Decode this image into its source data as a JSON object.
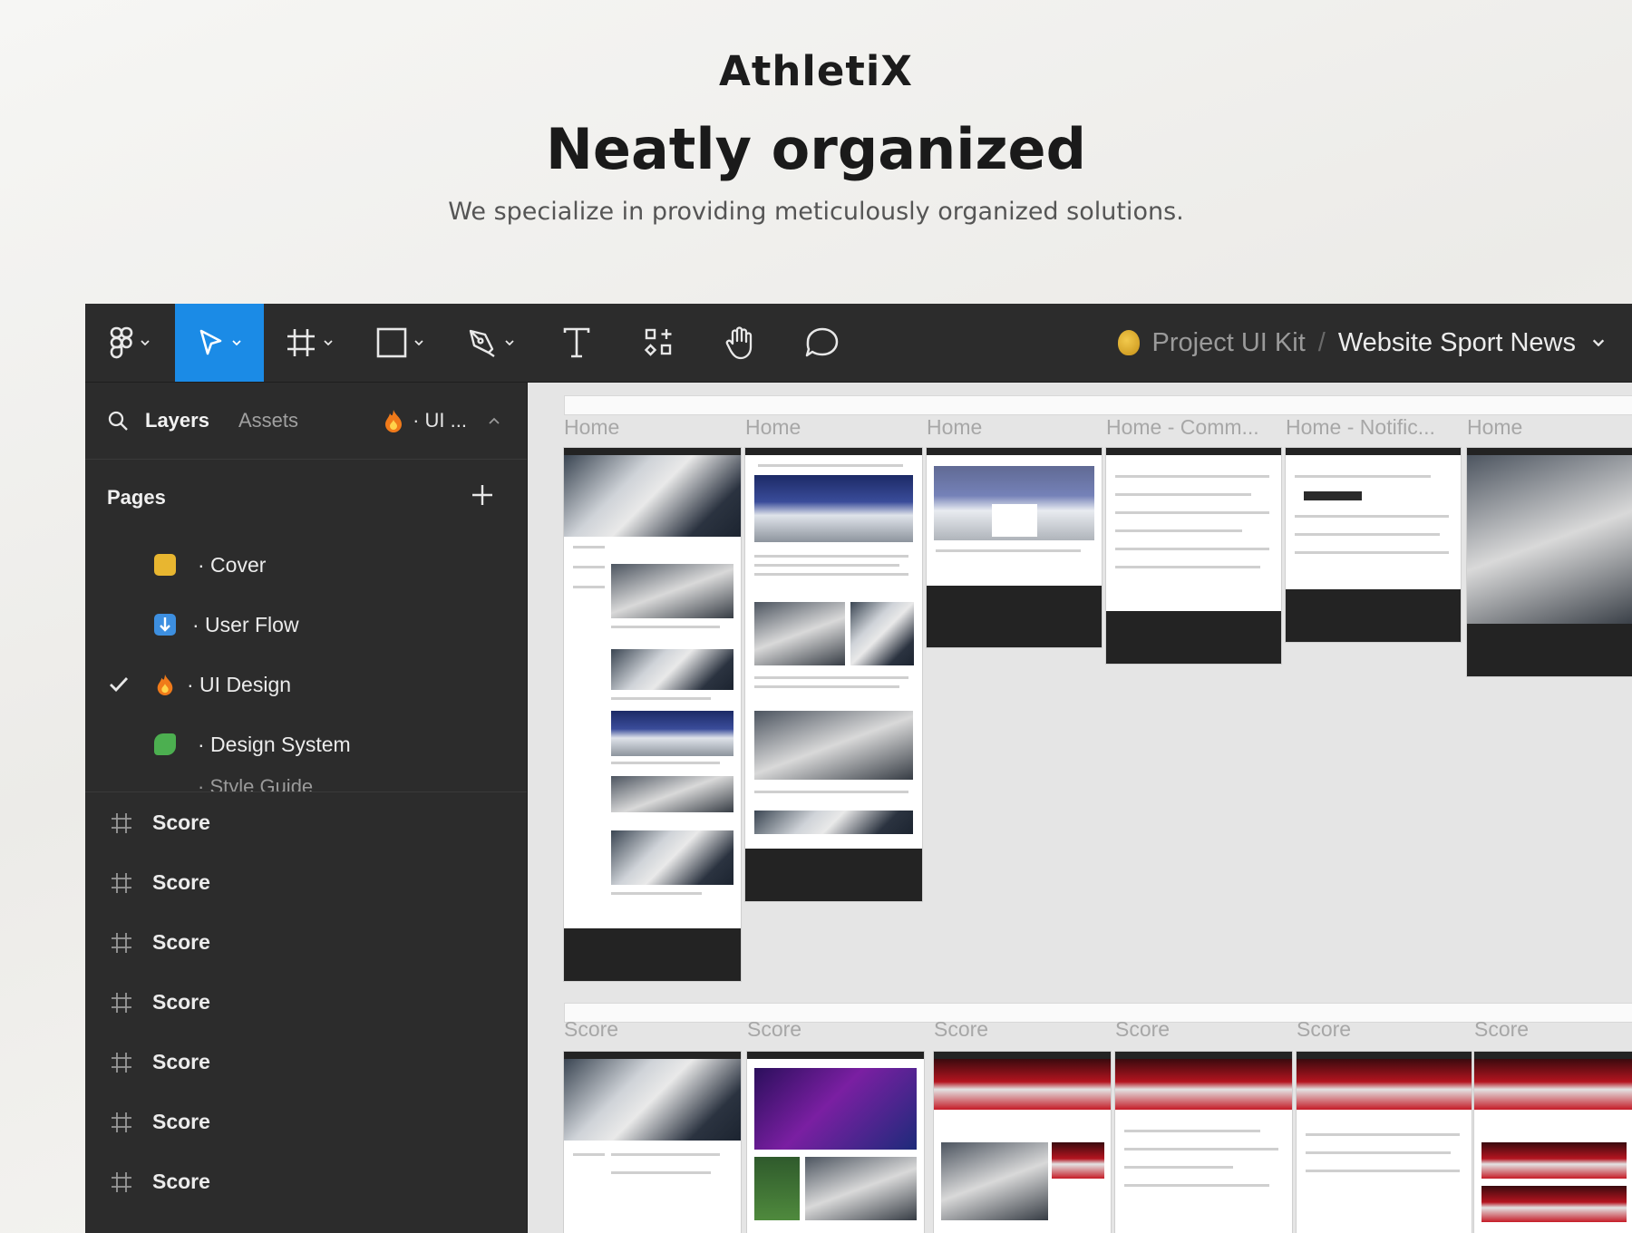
{
  "hero": {
    "brand": "AthletiX",
    "headline": "Neatly organized",
    "subtitle": "We specialize in providing meticulously organized solutions."
  },
  "toolbar": {
    "tools": [
      {
        "name": "main-menu",
        "icon": "figma-logo-icon",
        "active": false
      },
      {
        "name": "move",
        "icon": "cursor-arrow-icon",
        "active": true
      },
      {
        "name": "frame",
        "icon": "frame-hash-icon",
        "active": false
      },
      {
        "name": "shape",
        "icon": "rectangle-icon",
        "active": false
      },
      {
        "name": "pen",
        "icon": "pen-nib-icon",
        "active": false
      },
      {
        "name": "text",
        "icon": "text-t-icon",
        "active": false
      },
      {
        "name": "resources",
        "icon": "components-icon",
        "active": false
      },
      {
        "name": "hand",
        "icon": "hand-icon",
        "active": false
      },
      {
        "name": "comment",
        "icon": "comment-bubble-icon",
        "active": false
      }
    ],
    "project": "Project UI Kit",
    "separator": "/",
    "file": "Website Sport News",
    "project_icon": "money-bag-icon"
  },
  "sidebar": {
    "tab_layers": "Layers",
    "tab_assets": "Assets",
    "current_page_short": "· UI ...",
    "pages_title": "Pages",
    "pages": [
      {
        "emoji": "clapping-hands-icon",
        "emoji_color": "#e8b630",
        "label": "· Cover",
        "selected": false
      },
      {
        "emoji": "down-arrow-box-icon",
        "emoji_color": "#3d8fe0",
        "label": "· User Flow",
        "selected": false
      },
      {
        "emoji": "fire-icon",
        "emoji_color": "#f07a1a",
        "label": "· UI Design",
        "selected": true
      },
      {
        "emoji": "puzzle-piece-icon",
        "emoji_color": "#4caf50",
        "label": "· Design System",
        "selected": false
      }
    ],
    "pages_overflow": "· Style Guide",
    "layers": [
      "Score",
      "Score",
      "Score",
      "Score",
      "Score",
      "Score",
      "Score"
    ]
  },
  "canvas": {
    "row1_labels": [
      "Home",
      "Home",
      "Home",
      "Home - Comm...",
      "Home - Notific...",
      "Home"
    ],
    "row2_labels": [
      "Score",
      "Score",
      "Score",
      "Score",
      "Score",
      "Score"
    ]
  },
  "colors": {
    "accent": "#1b8be6",
    "panel": "#2c2c2c",
    "canvas": "#e5e5e5"
  }
}
